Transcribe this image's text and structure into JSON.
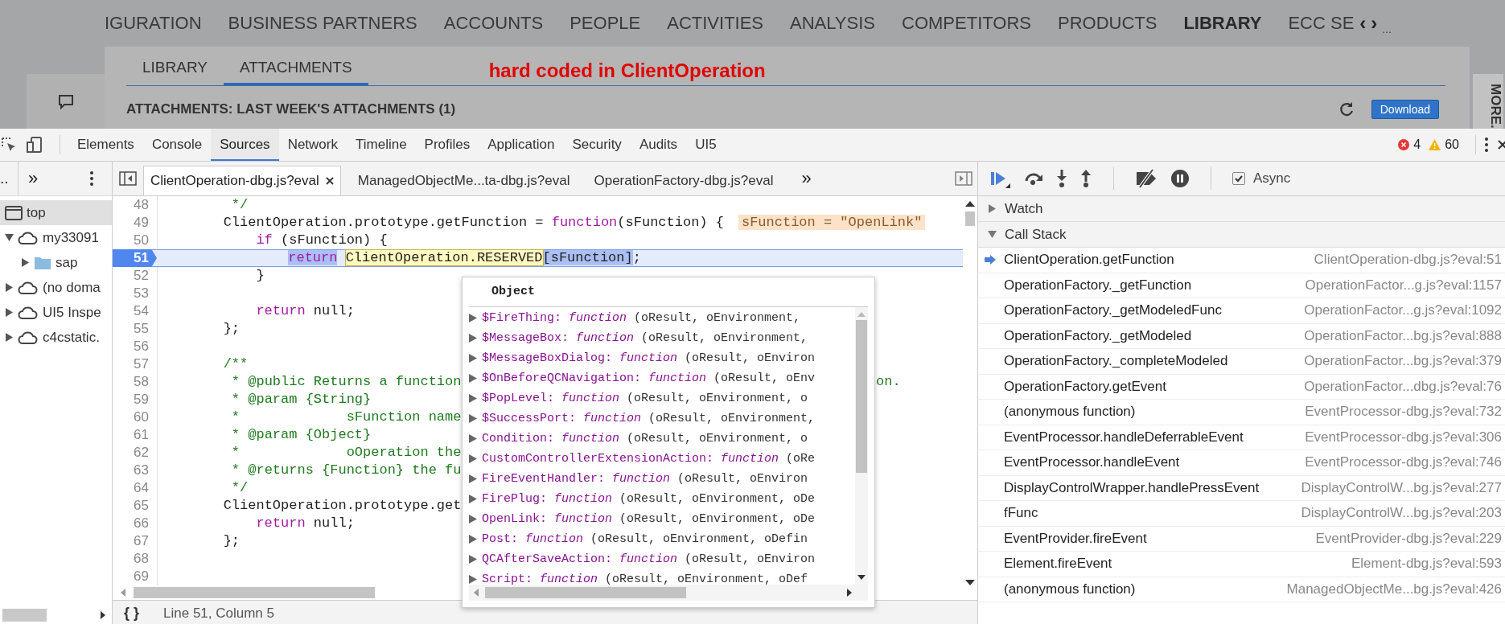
{
  "page": {
    "nav": [
      {
        "label": "IGURATION",
        "selected": false
      },
      {
        "label": "BUSINESS PARTNERS",
        "selected": false
      },
      {
        "label": "ACCOUNTS",
        "selected": false
      },
      {
        "label": "PEOPLE",
        "selected": false
      },
      {
        "label": "ACTIVITIES",
        "selected": false
      },
      {
        "label": "ANALYSIS",
        "selected": false
      },
      {
        "label": "COMPETITORS",
        "selected": false
      },
      {
        "label": "PRODUCTS",
        "selected": false
      },
      {
        "label": "LIBRARY",
        "selected": true
      },
      {
        "label": "ECC SE",
        "selected": false
      }
    ],
    "nav_prev": "‹",
    "nav_next": "›",
    "nav_more": "...",
    "subtabs": [
      {
        "label": "LIBRARY",
        "selected": false
      },
      {
        "label": "ATTACHMENTS",
        "selected": true
      }
    ],
    "annotation": "hard coded in ClientOperation",
    "section_title": "ATTACHMENTS: LAST WEEK'S ATTACHMENTS (1)",
    "download_button": "Download",
    "side_tab": "MORE."
  },
  "devtools": {
    "tabs": [
      {
        "label": "Elements",
        "selected": false
      },
      {
        "label": "Console",
        "selected": false
      },
      {
        "label": "Sources",
        "selected": true
      },
      {
        "label": "Network",
        "selected": false
      },
      {
        "label": "Timeline",
        "selected": false
      },
      {
        "label": "Profiles",
        "selected": false
      },
      {
        "label": "Application",
        "selected": false
      },
      {
        "label": "Security",
        "selected": false
      },
      {
        "label": "Audits",
        "selected": false
      },
      {
        "label": "UI5",
        "selected": false
      }
    ],
    "errors": "4",
    "warnings": "60"
  },
  "navigator": {
    "more": "..",
    "overflow": "»",
    "tree": [
      {
        "label": "top",
        "kind": "frame",
        "selected": true
      },
      {
        "label": "my33091",
        "kind": "domain",
        "expanded": true,
        "selected": false,
        "children": [
          {
            "label": "sap",
            "kind": "folder",
            "expanded": false,
            "selected": false
          }
        ]
      },
      {
        "label": "(no doma",
        "kind": "domain",
        "expanded": false,
        "selected": false
      },
      {
        "label": "UI5 Inspe",
        "kind": "domain",
        "expanded": false,
        "selected": false
      },
      {
        "label": "c4cstatic.",
        "kind": "domain",
        "expanded": false,
        "selected": false
      }
    ]
  },
  "editor": {
    "tabs": [
      {
        "label": "ClientOperation-dbg.js?eval",
        "selected": true,
        "closable": true
      },
      {
        "label": "ManagedObjectMe...ta-dbg.js?eval",
        "selected": false,
        "closable": false
      },
      {
        "label": "OperationFactory-dbg.js?eval",
        "selected": false,
        "closable": false
      }
    ],
    "overflow": "»",
    "lines": [
      {
        "number": "48",
        "current": false,
        "segments": [
          {
            "kind": "comment",
            "text": "         */"
          }
        ]
      },
      {
        "number": "49",
        "current": false,
        "segments": [
          {
            "kind": "plain",
            "text": "        ClientOperation.prototype.getFunction = "
          },
          {
            "kind": "keyword",
            "text": "function"
          },
          {
            "kind": "plain",
            "text": "(sFunction) {"
          },
          {
            "kind": "inline",
            "text": "sFunction = \"OpenLink\""
          }
        ]
      },
      {
        "number": "50",
        "current": false,
        "segments": [
          {
            "kind": "keyword",
            "text": "            if"
          },
          {
            "kind": "plain",
            "text": " (sFunction) {"
          }
        ]
      },
      {
        "number": "51",
        "current": true,
        "segments": [
          {
            "kind": "exec",
            "text": "                return"
          },
          {
            "kind": "eval",
            "text": " ClientOperation.RESERVED"
          },
          {
            "kind": "sel",
            "text": "[sFunction]"
          },
          {
            "kind": "plain",
            "text": ";"
          }
        ]
      },
      {
        "number": "52",
        "current": false,
        "segments": [
          {
            "kind": "plain",
            "text": "            }"
          }
        ]
      },
      {
        "number": "53",
        "current": false
      },
      {
        "number": "54",
        "current": false,
        "segments": [
          {
            "kind": "keyword",
            "text": "            return"
          },
          {
            "kind": "plain",
            "text": " null;"
          }
        ]
      },
      {
        "number": "55",
        "current": false,
        "segments": [
          {
            "kind": "plain",
            "text": "        };"
          }
        ]
      },
      {
        "number": "56",
        "current": false
      },
      {
        "number": "57",
        "current": false,
        "segments": [
          {
            "kind": "comment",
            "text": "        /**"
          }
        ]
      },
      {
        "number": "58",
        "current": false,
        "segments": [
          {
            "kind": "comment",
            "text": "         * @public Returns a function"
          },
          {
            "kind": "tail",
            "text": "on."
          }
        ]
      },
      {
        "number": "59",
        "current": false,
        "segments": [
          {
            "kind": "comment",
            "text": "         * @param {String}"
          }
        ]
      },
      {
        "number": "60",
        "current": false,
        "segments": [
          {
            "kind": "comment",
            "text": "         *             sFunction name"
          }
        ]
      },
      {
        "number": "61",
        "current": false,
        "segments": [
          {
            "kind": "comment",
            "text": "         * @param {Object}"
          }
        ]
      },
      {
        "number": "62",
        "current": false,
        "segments": [
          {
            "kind": "comment",
            "text": "         *             oOperation the"
          }
        ]
      },
      {
        "number": "63",
        "current": false,
        "segments": [
          {
            "kind": "comment",
            "text": "         * @returns {Function} the fu"
          }
        ]
      },
      {
        "number": "64",
        "current": false,
        "segments": [
          {
            "kind": "comment",
            "text": "         */"
          }
        ]
      },
      {
        "number": "65",
        "current": false,
        "segments": [
          {
            "kind": "plain",
            "text": "        ClientOperation.prototype.get"
          }
        ]
      },
      {
        "number": "66",
        "current": false,
        "segments": [
          {
            "kind": "keyword",
            "text": "            return"
          },
          {
            "kind": "plain",
            "text": " null;"
          }
        ]
      },
      {
        "number": "67",
        "current": false,
        "segments": [
          {
            "kind": "plain",
            "text": "        };"
          }
        ]
      },
      {
        "number": "68",
        "current": false
      },
      {
        "number": "69",
        "current": false
      }
    ],
    "pretty_print": "{ }",
    "status": "Line 51, Column 5"
  },
  "popover": {
    "title": "Object",
    "entries": [
      {
        "name": "$FireThing:",
        "type": "function",
        "args": "(oResult, oEnvironment,"
      },
      {
        "name": "$MessageBox:",
        "type": "function",
        "args": "(oResult, oEnvironment,"
      },
      {
        "name": "$MessageBoxDialog:",
        "type": "function",
        "args": "(oResult, oEnviron"
      },
      {
        "name": "$OnBeforeQCNavigation:",
        "type": "function",
        "args": "(oResult, oEnv"
      },
      {
        "name": "$PopLevel:",
        "type": "function",
        "args": "(oResult, oEnvironment, o"
      },
      {
        "name": "$SuccessPort:",
        "type": "function",
        "args": "(oResult, oEnvironment,"
      },
      {
        "name": "Condition:",
        "type": "function",
        "args": "(oResult, oEnvironment, o"
      },
      {
        "name": "CustomControllerExtensionAction:",
        "type": "function",
        "args": "(oRe"
      },
      {
        "name": "FireEventHandler:",
        "type": "function",
        "args": "(oResult, oEnviron"
      },
      {
        "name": "FirePlug:",
        "type": "function",
        "args": "(oResult, oEnvironment, oDe"
      },
      {
        "name": "OpenLink:",
        "type": "function",
        "args": "(oResult, oEnvironment, oDe"
      },
      {
        "name": "Post:",
        "type": "function",
        "args": "(oResult, oEnvironment, oDefin"
      },
      {
        "name": "QCAfterSaveAction:",
        "type": "function",
        "args": "(oResult, oEnviron"
      },
      {
        "name": "Script:",
        "type": "function",
        "args": "(oResult, oEnvironment, oDef"
      }
    ]
  },
  "debugger": {
    "async": {
      "label": "Async",
      "checked": true
    },
    "sections": [
      {
        "label": "Watch",
        "expanded": false
      },
      {
        "label": "Call Stack",
        "expanded": true
      }
    ],
    "call_stack": [
      {
        "function": "ClientOperation.getFunction",
        "location": "ClientOperation-dbg.js?eval:51",
        "current": true
      },
      {
        "function": "OperationFactory._getFunction",
        "location": "OperationFactor...g.js?eval:1157",
        "current": false
      },
      {
        "function": "OperationFactory._getModeledFunc",
        "location": "OperationFactor...g.js?eval:1092",
        "current": false
      },
      {
        "function": "OperationFactory._getModeled",
        "location": "OperationFactor...bg.js?eval:888",
        "current": false
      },
      {
        "function": "OperationFactory._completeModeled",
        "location": "OperationFactor...bg.js?eval:379",
        "current": false
      },
      {
        "function": "OperationFactory.getEvent",
        "location": "OperationFactor...dbg.js?eval:76",
        "current": false
      },
      {
        "function": "(anonymous function)",
        "location": "EventProcessor-dbg.js?eval:732",
        "current": false
      },
      {
        "function": "EventProcessor.handleDeferrableEvent",
        "location": "EventProcessor-dbg.js?eval:306",
        "current": false
      },
      {
        "function": "EventProcessor.handleEvent",
        "location": "EventProcessor-dbg.js?eval:746",
        "current": false
      },
      {
        "function": "DisplayControlWrapper.handlePressEvent",
        "location": "DisplayControlW...bg.js?eval:277",
        "current": false
      },
      {
        "function": "fFunc",
        "location": "DisplayControlW...bg.js?eval:203",
        "current": false
      },
      {
        "function": "EventProvider.fireEvent",
        "location": "EventProvider-dbg.js?eval:229",
        "current": false
      },
      {
        "function": "Element.fireEvent",
        "location": "Element-dbg.js?eval:593",
        "current": false
      },
      {
        "function": "(anonymous function)",
        "location": "ManagedObjectMe...bg.js?eval:426",
        "current": false
      }
    ]
  }
}
